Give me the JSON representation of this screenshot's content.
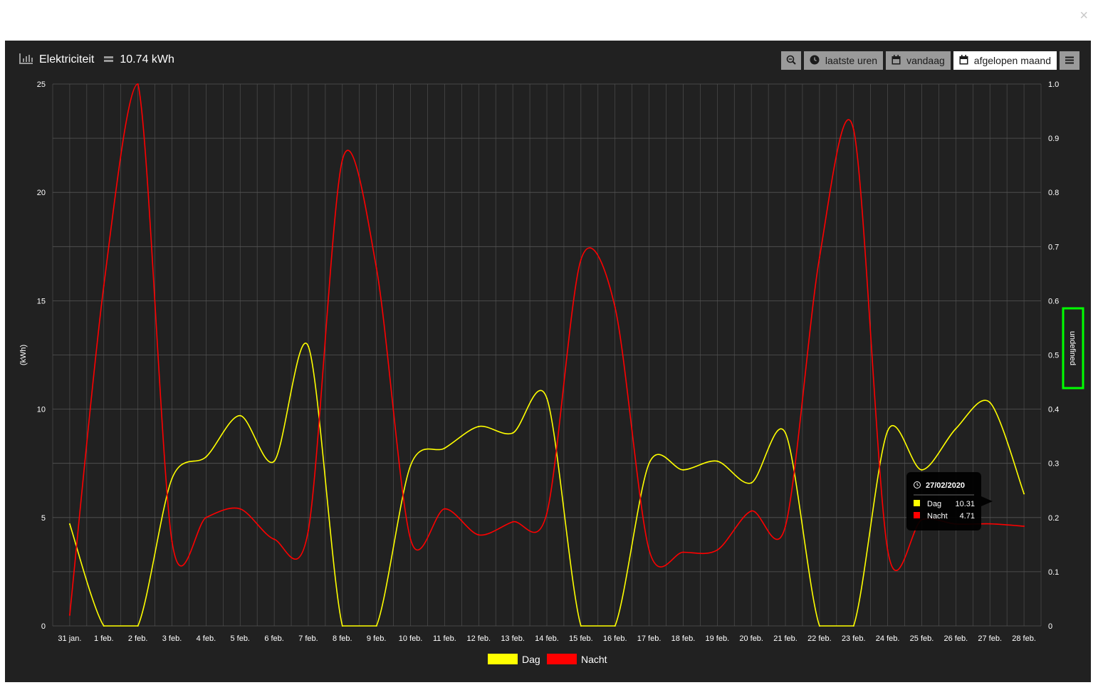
{
  "window": {
    "close_label": "×"
  },
  "header": {
    "title": "Elektriciteit",
    "value": "10.74 kWh",
    "icon": "bar-chart-icon"
  },
  "toolbar": {
    "zoom_icon": "zoom-out-icon",
    "buttons": [
      {
        "label": "laatste uren",
        "icon": "clock-icon",
        "active": false
      },
      {
        "label": "vandaag",
        "icon": "calendar-icon",
        "active": false
      },
      {
        "label": "afgelopen maand",
        "icon": "calendar-icon",
        "active": true
      }
    ],
    "menu_icon": "hamburger-menu-icon"
  },
  "colors": {
    "background": "#212121",
    "grid": "#555555",
    "dag": "#ffff00",
    "nacht": "#ff0000",
    "highlight": "#00ff00"
  },
  "chart_data": {
    "type": "line",
    "x": [
      "31 jan.",
      "1 feb.",
      "2 feb.",
      "3 feb.",
      "4 feb.",
      "5 feb.",
      "6 feb.",
      "7 feb.",
      "8 feb.",
      "9 feb.",
      "10 feb.",
      "11 feb.",
      "12 feb.",
      "13 feb.",
      "14 feb.",
      "15 feb.",
      "16 feb.",
      "17 feb.",
      "18 feb.",
      "19 feb.",
      "20 feb.",
      "21 feb.",
      "22 feb.",
      "23 feb.",
      "24 feb.",
      "25 feb.",
      "26 feb.",
      "27 feb.",
      "28 feb."
    ],
    "series": [
      {
        "name": "Dag",
        "color": "#ffff00",
        "values": [
          4.7,
          0,
          0,
          6.8,
          7.8,
          9.7,
          7.6,
          12.9,
          0,
          0,
          7.4,
          8.2,
          9.2,
          8.9,
          10.5,
          0,
          0,
          7.5,
          7.2,
          7.6,
          6.6,
          8.9,
          0,
          0,
          9.0,
          7.2,
          9.1,
          10.31,
          6.1
        ]
      },
      {
        "name": "Nacht",
        "color": "#ff0000",
        "values": [
          0.5,
          15.7,
          25.0,
          3.9,
          5.0,
          5.4,
          4.0,
          4.4,
          21.5,
          16.5,
          4.0,
          5.4,
          4.2,
          4.8,
          5.2,
          16.9,
          14.7,
          3.5,
          3.4,
          3.5,
          5.3,
          4.6,
          17.0,
          22.9,
          3.5,
          4.9,
          4.7,
          4.71,
          4.6
        ]
      }
    ],
    "ylabel": "(kWh)",
    "ylim": [
      0,
      25
    ],
    "yticks": [
      "0",
      "5",
      "10",
      "15",
      "20",
      "25"
    ],
    "y2label": "undefined",
    "y2lim": [
      0,
      1.0
    ],
    "y2ticks": [
      "0",
      "0.1",
      "0.2",
      "0.3",
      "0.4",
      "0.5",
      "0.6",
      "0.7",
      "0.8",
      "0.9",
      "1.0"
    ],
    "grid": true,
    "legend": [
      {
        "name": "Dag",
        "color": "#ffff00"
      },
      {
        "name": "Nacht",
        "color": "#ff0000"
      }
    ],
    "legend_position": "bottom-center",
    "tooltip": {
      "title": "27/02/2020",
      "icon": "clock-icon",
      "rows": [
        {
          "name": "Dag",
          "value": "10.31",
          "color": "#ffff00"
        },
        {
          "name": "Nacht",
          "value": "4.71",
          "color": "#ff0000"
        }
      ]
    }
  }
}
